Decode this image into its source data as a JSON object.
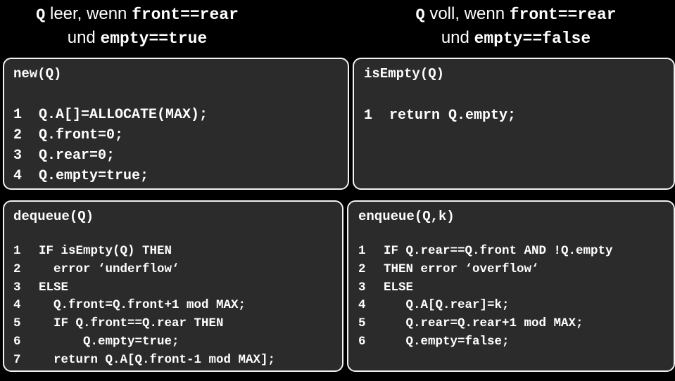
{
  "header_left": {
    "q": "Q",
    "text1": " leer, wenn ",
    "cond1": "front==rear",
    "text2": "und ",
    "cond2": "empty==true"
  },
  "header_right": {
    "q": "Q",
    "text1": " voll, wenn ",
    "cond1": "front==rear",
    "text2": "und ",
    "cond2": "empty==false"
  },
  "boxes": {
    "new": {
      "title": "new(Q)",
      "lines": [
        {
          "num": "1",
          "code": "Q.A[]=ALLOCATE(MAX);"
        },
        {
          "num": "2",
          "code": "Q.front=0;"
        },
        {
          "num": "3",
          "code": "Q.rear=0;"
        },
        {
          "num": "4",
          "code": "Q.empty=true;"
        }
      ]
    },
    "isempty": {
      "title": "isEmpty(Q)",
      "lines": [
        {
          "num": "1",
          "code": "return Q.empty;"
        }
      ]
    },
    "dequeue": {
      "title": "dequeue(Q)",
      "lines": [
        {
          "num": "1",
          "code": "IF isEmpty(Q) THEN"
        },
        {
          "num": "2",
          "code": "  error ‘underflow‘"
        },
        {
          "num": "3",
          "code": "ELSE"
        },
        {
          "num": "4",
          "code": "  Q.front=Q.front+1 mod MAX;"
        },
        {
          "num": "5",
          "code": "  IF Q.front==Q.rear THEN"
        },
        {
          "num": "6",
          "code": "      Q.empty=true;"
        },
        {
          "num": "7",
          "code": "  return Q.A[Q.front-1 mod MAX];"
        }
      ]
    },
    "enqueue": {
      "title": "enqueue(Q,k)",
      "lines": [
        {
          "num": "1",
          "code": "IF Q.rear==Q.front AND !Q.empty"
        },
        {
          "num": "2",
          "code": "THEN error ‘overflow‘"
        },
        {
          "num": "3",
          "code": "ELSE"
        },
        {
          "num": "4",
          "code": "   Q.A[Q.rear]=k;"
        },
        {
          "num": "5",
          "code": "   Q.rear=Q.rear+1 mod MAX;"
        },
        {
          "num": "6",
          "code": "   Q.empty=false;"
        }
      ]
    }
  },
  "colors": {
    "background": "#000000",
    "box_fill": "#2b2b2b",
    "box_border": "#f2f2f2",
    "text": "#ffffff"
  }
}
